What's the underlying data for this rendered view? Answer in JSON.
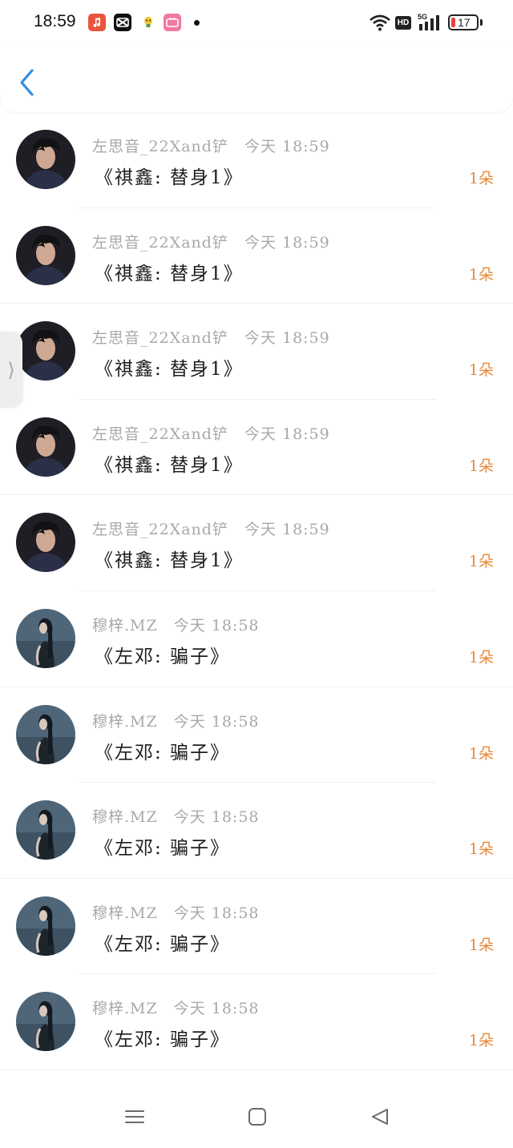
{
  "status_bar": {
    "time": "18:59",
    "network": "5G",
    "hd_label": "HD",
    "battery_level": "17",
    "battery_fraction": 0.17,
    "app_icons": [
      "music-app-icon",
      "capcut-icon",
      "lightbulb-app-icon",
      "bilibili-icon"
    ]
  },
  "header": {
    "back_icon": "chevron-left-icon"
  },
  "gifts": [
    {
      "user": "左思音_22Xand铲",
      "time": "今天 18:59",
      "title": "《祺鑫: 替身1》",
      "count": "1朵",
      "avatar": "boy"
    },
    {
      "user": "左思音_22Xand铲",
      "time": "今天 18:59",
      "title": "《祺鑫: 替身1》",
      "count": "1朵",
      "avatar": "boy"
    },
    {
      "user": "左思音_22Xand铲",
      "time": "今天 18:59",
      "title": "《祺鑫: 替身1》",
      "count": "1朵",
      "avatar": "boy"
    },
    {
      "user": "左思音_22Xand铲",
      "time": "今天 18:59",
      "title": "《祺鑫: 替身1》",
      "count": "1朵",
      "avatar": "boy"
    },
    {
      "user": "左思音_22Xand铲",
      "time": "今天 18:59",
      "title": "《祺鑫: 替身1》",
      "count": "1朵",
      "avatar": "boy"
    },
    {
      "user": "穆梓.MZ",
      "time": "今天 18:58",
      "title": "《左邓: 骗子》",
      "count": "1朵",
      "avatar": "girl"
    },
    {
      "user": "穆梓.MZ",
      "time": "今天 18:58",
      "title": "《左邓: 骗子》",
      "count": "1朵",
      "avatar": "girl"
    },
    {
      "user": "穆梓.MZ",
      "time": "今天 18:58",
      "title": "《左邓: 骗子》",
      "count": "1朵",
      "avatar": "girl"
    },
    {
      "user": "穆梓.MZ",
      "time": "今天 18:58",
      "title": "《左邓: 骗子》",
      "count": "1朵",
      "avatar": "girl"
    },
    {
      "user": "穆梓.MZ",
      "time": "今天 18:58",
      "title": "《左邓: 骗子》",
      "count": "1朵",
      "avatar": "girl"
    }
  ],
  "colors": {
    "accent_back": "#2f8fe0",
    "count": "#e8893a",
    "meta": "#a8a8a8",
    "battery_low": "#e84040"
  },
  "navbar": {
    "icons": [
      "menu-icon",
      "home-square-icon",
      "back-triangle-icon"
    ]
  }
}
